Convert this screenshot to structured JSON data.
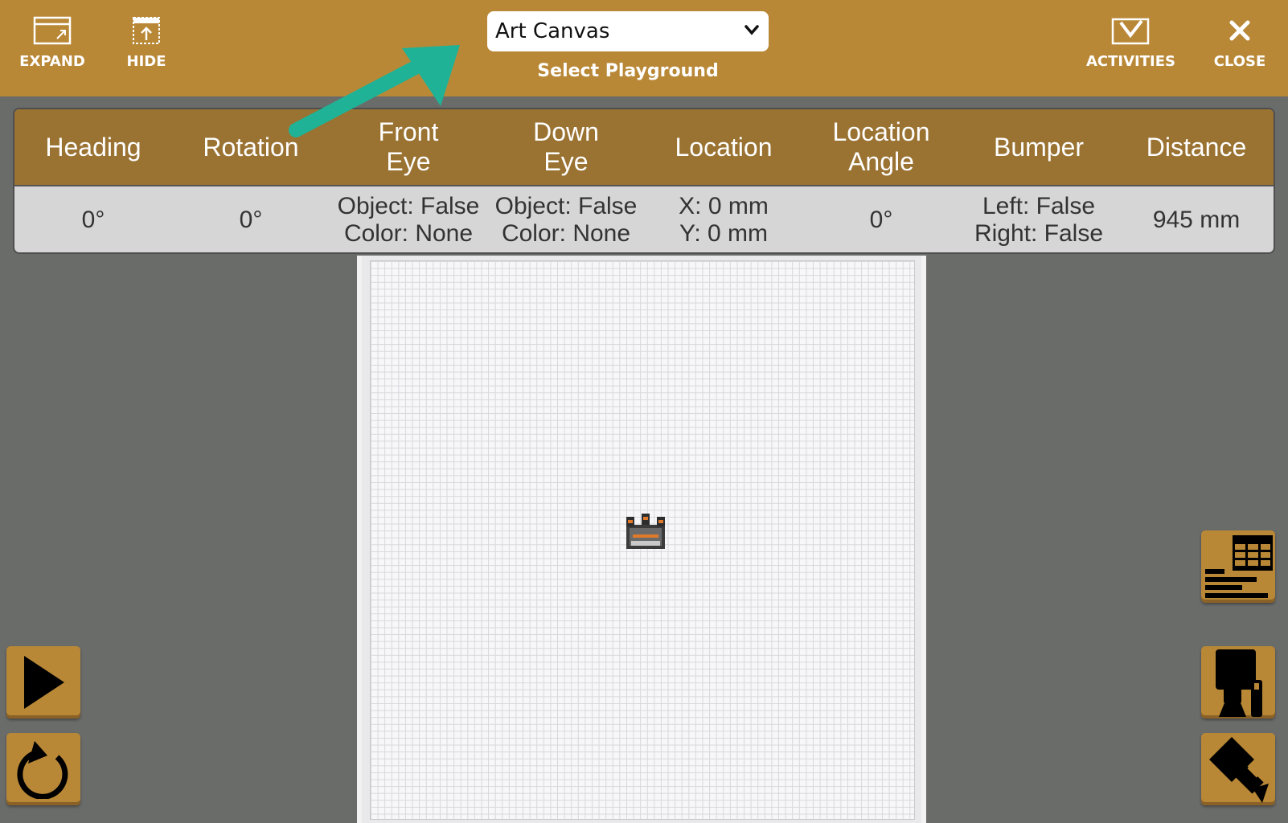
{
  "toolbar": {
    "expand_label": "EXPAND",
    "hide_label": "HIDE",
    "activities_label": "ACTIVITIES",
    "close_label": "CLOSE",
    "background_color": "#b98837"
  },
  "playground_select": {
    "value": "Art Canvas",
    "label": "Select Playground"
  },
  "sensor_table": {
    "headers": [
      "Heading",
      "Rotation",
      "Front\nEye",
      "Down\nEye",
      "Location",
      "Location\nAngle",
      "Bumper",
      "Distance"
    ],
    "values": [
      "0°",
      "0°",
      "Object: False\nColor: None",
      "Object: False\nColor: None",
      "X: 0 mm\nY: 0 mm",
      "0°",
      "Left: False\nRight: False",
      "945 mm"
    ]
  },
  "annotation": {
    "arrow_color": "#1fb296"
  },
  "controls": {
    "left": [
      "play-icon",
      "reset-icon"
    ],
    "right": [
      "data-table-icon",
      "robot-camera-icon",
      "overhead-camera-icon"
    ]
  }
}
